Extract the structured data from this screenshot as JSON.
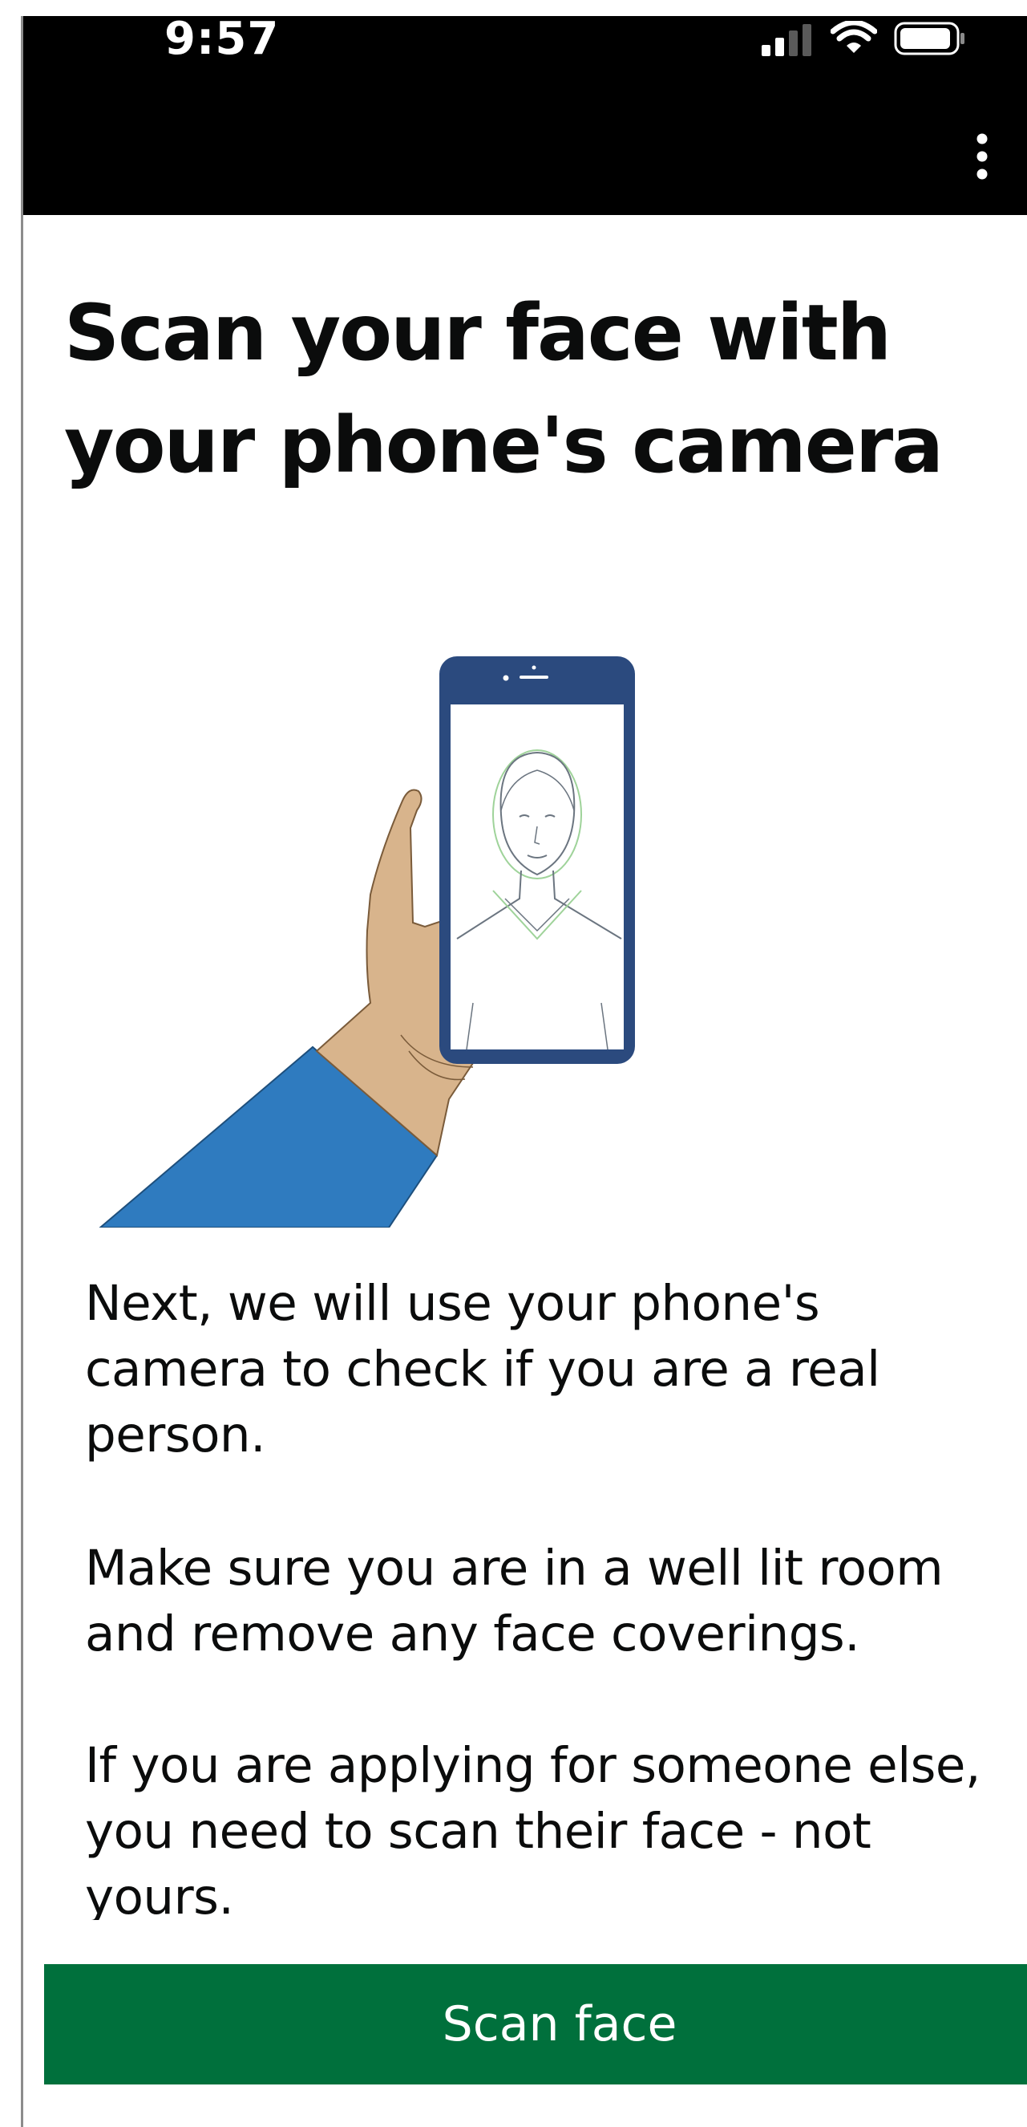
{
  "status_bar": {
    "time": "9:57",
    "icons": [
      "signal-icon",
      "wifi-icon",
      "battery-icon"
    ]
  },
  "app_bar": {
    "menu_icon": "more-vertical-icon"
  },
  "page": {
    "title": "Scan your face with your phone's camera",
    "illustration": "hand-holding-phone-face-scan-illustration",
    "paragraphs": [
      "Next, we will use your phone's camera to check if you are a real person.",
      "Make sure you are in a well lit room and remove any face coverings.",
      "If you are applying for someone else, you need to scan their face - not yours."
    ]
  },
  "actions": {
    "primary_label": "Scan face"
  },
  "colors": {
    "primary_button": "#00703c",
    "header_background": "#000000",
    "phone_frame": "#2b4a7e",
    "sleeve": "#2f7bbf",
    "skin": "#d8b48c"
  }
}
